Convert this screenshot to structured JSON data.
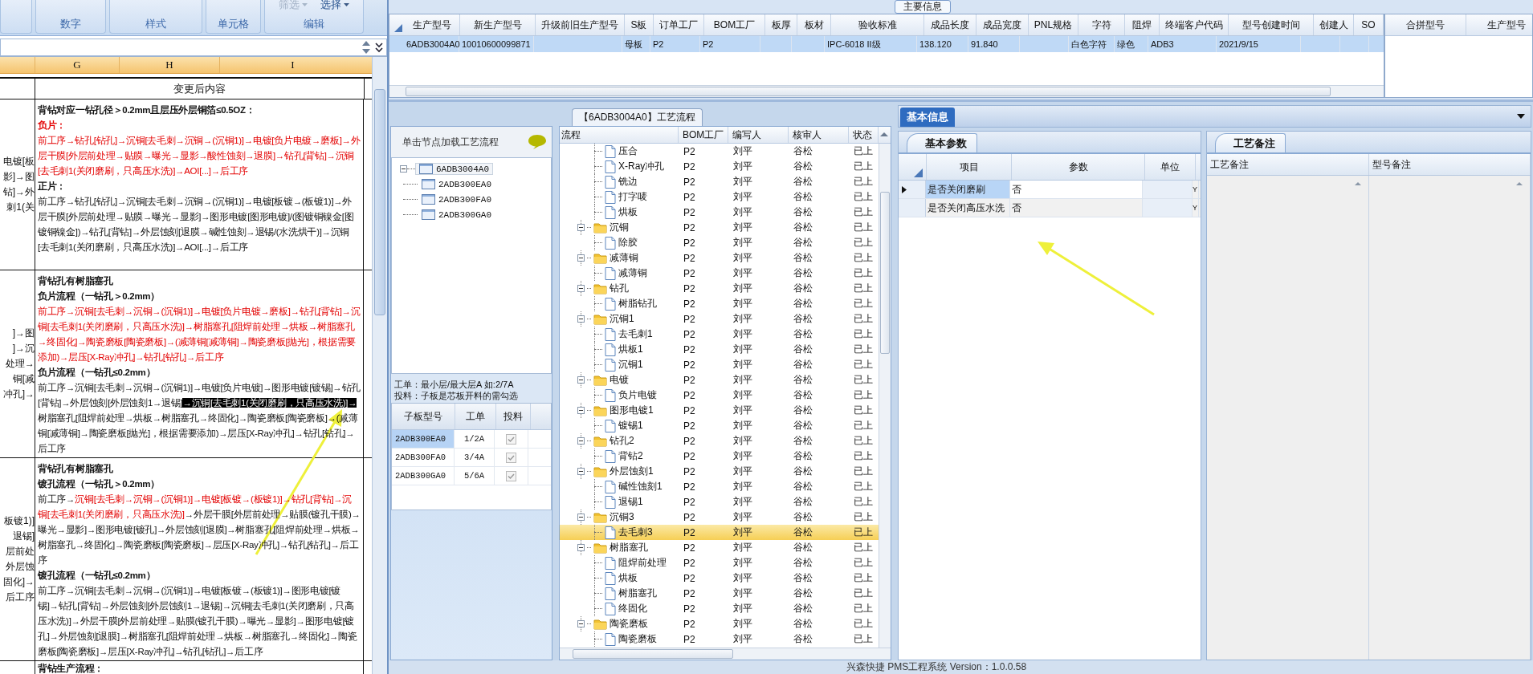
{
  "excel": {
    "ribbon": {
      "groups": [
        "数字",
        "样式",
        "单元格",
        "编辑"
      ],
      "menu_buttons": [
        {
          "label": "筛选",
          "disabled": true
        },
        {
          "label": "选择",
          "disabled": false
        }
      ]
    },
    "columns": [
      "G",
      "H",
      "I"
    ],
    "header": "变更后内容",
    "rows": [
      {
        "left_fragments": [
          "电镀[板",
          "影]→图",
          "钻]→外",
          "刺1(关"
        ],
        "paragraphs": [
          {
            "bold": true,
            "segments": [
              {
                "kind": "normal",
                "text": "背钻对应一钻孔径＞0.2mm且层压外层铜箔≤0.5OZ："
              }
            ]
          },
          {
            "bold": true,
            "segments": [
              {
                "kind": "red",
                "text": "负片："
              }
            ]
          },
          {
            "bold": false,
            "segments": [
              {
                "kind": "red",
                "text": "前工序→钻孔[钻孔]→沉铜[去毛刺→沉铜→(沉铜1)]→电镀[负片电镀→磨板]→外层干膜[外层前处理→贴膜→曝光→显影→酸性蚀刻→退膜]→钻孔[背钻]→沉铜[去毛刺1(关闭磨刷，只高压水洗)]→AOI[...]→后工序"
              }
            ]
          },
          {
            "bold": true,
            "segments": [
              {
                "kind": "normal",
                "text": "正片："
              }
            ]
          },
          {
            "bold": false,
            "segments": [
              {
                "kind": "normal",
                "text": "前工序→钻孔[钻孔]→沉铜[去毛刺→沉铜→(沉铜1)]→电镀[板镀→(板镀1)]→外层干膜[外层前处理→贴膜→曝光→显影]→图形电镀[图形电镀]/(图镀铜镍金[图镀铜镍金])→钻孔[背钻]→外层蚀刻[退膜→碱性蚀刻→退锡/(水洗烘干)]→沉铜[去毛刺1(关闭磨刷，只高压水洗)]→AOI[...]→后工序"
              }
            ]
          }
        ]
      },
      {
        "left_fragments": [
          "]→图",
          "]→沉",
          "处理→",
          "铜[减",
          "冲孔]→"
        ],
        "paragraphs": [
          {
            "bold": true,
            "segments": [
              {
                "kind": "normal",
                "text": "背钻孔有树脂塞孔"
              }
            ]
          },
          {
            "bold": true,
            "segments": [
              {
                "kind": "normal",
                "text": "负片流程（一钻孔＞0.2mm）"
              }
            ]
          },
          {
            "bold": false,
            "segments": [
              {
                "kind": "red",
                "text": "前工序→沉铜[去毛刺→沉铜→(沉铜1)]→电镀[负片电镀→磨板]→钻孔[背钻]→沉铜[去毛刺1(关闭磨刷，只高压水洗)]→树脂塞孔[阻焊前处理→烘板→树脂塞孔→终固化]→陶瓷磨板[陶瓷磨板]→(减薄铜[减薄铜]→陶瓷磨板[抛光]，根据需要添加)→层压[X-Ray冲孔]→钻孔[钻孔]→后工序"
              }
            ]
          },
          {
            "bold": true,
            "segments": [
              {
                "kind": "normal",
                "text": "负片流程（一钻孔≤0.2mm）"
              }
            ]
          },
          {
            "bold": false,
            "segments": [
              {
                "kind": "normal",
                "text": "前工序→沉铜[去毛刺→沉铜→(沉铜1)]→电镀[负片电镀]→图形电镀[镀锡]→钻孔[背钻]→外层蚀刻[外层蚀刻1→退锡]"
              },
              {
                "kind": "highlight",
                "text": "→沉铜[去毛刺1(关闭磨刷，只高压水洗)]→"
              },
              {
                "kind": "normal",
                "text": "树脂塞孔[阻焊前处理→烘板→树脂塞孔→终固化]→陶瓷磨板[陶瓷磨板]→(减薄铜[减薄铜]→陶瓷磨板[抛光]，根据需要添加)→层压[X-Ray冲孔]→钻孔[钻孔]→后工序"
              }
            ]
          }
        ]
      },
      {
        "left_fragments": [
          "板镀1)]",
          "退锡]",
          "层前处",
          "外层蚀",
          "固化]→",
          "后工序"
        ],
        "paragraphs": [
          {
            "bold": true,
            "segments": [
              {
                "kind": "normal",
                "text": "背钻孔有树脂塞孔"
              }
            ]
          },
          {
            "bold": true,
            "segments": [
              {
                "kind": "normal",
                "text": "镀孔流程（一钻孔＞0.2mm）"
              }
            ]
          },
          {
            "bold": false,
            "segments": [
              {
                "kind": "normal",
                "text": "前工序→"
              },
              {
                "kind": "red",
                "text": "沉铜[去毛刺→沉铜→(沉铜1)]→电镀[板镀→(板镀1)]→钻孔[背钻]→沉铜[去毛刺1(关闭磨刷，只高压水洗)]"
              },
              {
                "kind": "normal",
                "text": "→外层干膜[外层前处理→贴膜(镀孔干膜)→曝光→显影]→图形电镀[镀孔]→外层蚀刻[退膜]→树脂塞孔[阻焊前处理→烘板→树脂塞孔→终固化]→陶瓷磨板[陶瓷磨板]→层压[X-Ray冲孔]→钻孔[钻孔]→后工序"
              }
            ]
          },
          {
            "bold": true,
            "segments": [
              {
                "kind": "normal",
                "text": "镀孔流程（一钻孔≤0.2mm）"
              }
            ]
          },
          {
            "bold": false,
            "segments": [
              {
                "kind": "normal",
                "text": "前工序→沉铜[去毛刺→沉铜→(沉铜1)]→电镀[板镀→(板镀1)]→图形电镀[镀锡]→钻孔[背钻]→外层蚀刻[外层蚀刻1→退锡]→沉铜[去毛刺1(关闭磨刷，只高压水洗)]→外层干膜[外层前处理→贴膜(镀孔干膜)→曝光→显影]→图形电镀[镀孔]→外层蚀刻[退膜]→树脂塞孔[阻焊前处理→烘板→树脂塞孔→终固化]→陶瓷磨板[陶瓷磨板]→层压[X-Ray冲孔]→钻孔[钻孔]→后工序"
              }
            ]
          }
        ]
      },
      {
        "paragraphs": [
          {
            "bold": true,
            "segments": [
              {
                "kind": "normal",
                "text": "背钻生产流程："
              }
            ]
          }
        ]
      }
    ]
  },
  "main_info": {
    "title": "主要信息",
    "columns": [
      "生产型号",
      "新生产型号",
      "升级前旧生产型号",
      "S板",
      "订单工厂",
      "BOM工厂",
      "板厚",
      "板材",
      "验收标准",
      "成品长度",
      "成品宽度",
      "PNL规格",
      "字符",
      "阻焊",
      "终端客户代码",
      "型号创建时间",
      "创建人",
      "SO"
    ],
    "rows": [
      {
        "selected": true,
        "cells": [
          "6ADB3004A0",
          "10010600099871",
          null,
          "母板",
          "P2",
          "P2",
          null,
          null,
          "IPC-6018 II级",
          "138.120",
          "91.840",
          null,
          "白色字符",
          "绿色",
          "ADB3",
          "2021/9/15",
          null,
          null
        ]
      }
    ],
    "merge_table": {
      "columns": [
        "合拼型号",
        "生产型号"
      ]
    }
  },
  "node_panel": {
    "hint": "单击节点加载工艺流程",
    "tree": {
      "label": "6ADB3004A0",
      "expanded": true,
      "selected": true,
      "children": [
        {
          "label": "2ADB300EA0",
          "selected": false
        },
        {
          "label": "2ADB300FA0",
          "selected": false
        },
        {
          "label": "2ADB300GA0",
          "selected": false
        }
      ]
    },
    "notes": [
      "工单：最小层/最大层A 如:2/7A",
      "投料：子板是芯板开料的需勾选"
    ],
    "sub_boards": {
      "columns": [
        "子板型号",
        "工单",
        "投料"
      ],
      "rows": [
        {
          "model": "2ADB300EA0",
          "order": "1/2A",
          "feed": true,
          "selected": true
        },
        {
          "model": "2ADB300FA0",
          "order": "3/4A",
          "feed": true,
          "selected": false
        },
        {
          "model": "2ADB300GA0",
          "order": "5/6A",
          "feed": true,
          "selected": false
        }
      ]
    }
  },
  "flow": {
    "tab": "【6ADB3004A0】工艺流程",
    "columns": [
      "流程",
      "BOM工厂",
      "编写人",
      "核审人",
      "状态"
    ],
    "continued_steps": [
      {
        "name": "压合",
        "bom": "P2",
        "author": "刘平",
        "reviewer": "谷松",
        "status": "已上",
        "selected": false
      },
      {
        "name": "X-Ray冲孔",
        "bom": "P2",
        "author": "刘平",
        "reviewer": "谷松",
        "status": "已上",
        "selected": false
      },
      {
        "name": "铣边",
        "bom": "P2",
        "author": "刘平",
        "reviewer": "谷松",
        "status": "已上",
        "selected": false
      },
      {
        "name": "打字唛",
        "bom": "P2",
        "author": "刘平",
        "reviewer": "谷松",
        "status": "已上",
        "selected": false
      },
      {
        "name": "烘板",
        "bom": "P2",
        "author": "刘平",
        "reviewer": "谷松",
        "status": "已上",
        "selected": false
      }
    ],
    "groups": [
      {
        "name": "沉铜",
        "bom": "P2",
        "author": "刘平",
        "reviewer": "谷松",
        "status": "已上",
        "selected": false,
        "expanded": true,
        "children": [
          {
            "name": "除胶",
            "bom": "P2",
            "author": "刘平",
            "reviewer": "谷松",
            "status": "已上",
            "selected": false
          }
        ]
      },
      {
        "name": "减薄铜",
        "bom": "P2",
        "author": "刘平",
        "reviewer": "谷松",
        "status": "已上",
        "selected": false,
        "expanded": true,
        "children": [
          {
            "name": "减薄铜",
            "bom": "P2",
            "author": "刘平",
            "reviewer": "谷松",
            "status": "已上",
            "selected": false
          }
        ]
      },
      {
        "name": "钻孔",
        "bom": "P2",
        "author": "刘平",
        "reviewer": "谷松",
        "status": "已上",
        "selected": false,
        "expanded": true,
        "children": [
          {
            "name": "树脂钻孔",
            "bom": "P2",
            "author": "刘平",
            "reviewer": "谷松",
            "status": "已上",
            "selected": false
          }
        ]
      },
      {
        "name": "沉铜1",
        "bom": "P2",
        "author": "刘平",
        "reviewer": "谷松",
        "status": "已上",
        "selected": false,
        "expanded": true,
        "children": [
          {
            "name": "去毛刺1",
            "bom": "P2",
            "author": "刘平",
            "reviewer": "谷松",
            "status": "已上",
            "selected": false
          },
          {
            "name": "烘板1",
            "bom": "P2",
            "author": "刘平",
            "reviewer": "谷松",
            "status": "已上",
            "selected": false
          },
          {
            "name": "沉铜1",
            "bom": "P2",
            "author": "刘平",
            "reviewer": "谷松",
            "status": "已上",
            "selected": false
          }
        ]
      },
      {
        "name": "电镀",
        "bom": "P2",
        "author": "刘平",
        "reviewer": "谷松",
        "status": "已上",
        "selected": false,
        "expanded": true,
        "children": [
          {
            "name": "负片电镀",
            "bom": "P2",
            "author": "刘平",
            "reviewer": "谷松",
            "status": "已上",
            "selected": false
          }
        ]
      },
      {
        "name": "图形电镀1",
        "bom": "P2",
        "author": "刘平",
        "reviewer": "谷松",
        "status": "已上",
        "selected": false,
        "expanded": true,
        "children": [
          {
            "name": "镀锡1",
            "bom": "P2",
            "author": "刘平",
            "reviewer": "谷松",
            "status": "已上",
            "selected": false
          }
        ]
      },
      {
        "name": "钻孔2",
        "bom": "P2",
        "author": "刘平",
        "reviewer": "谷松",
        "status": "已上",
        "selected": false,
        "expanded": true,
        "children": [
          {
            "name": "背钻2",
            "bom": "P2",
            "author": "刘平",
            "reviewer": "谷松",
            "status": "已上",
            "selected": false
          }
        ]
      },
      {
        "name": "外层蚀刻1",
        "bom": "P2",
        "author": "刘平",
        "reviewer": "谷松",
        "status": "已上",
        "selected": false,
        "expanded": true,
        "children": [
          {
            "name": "碱性蚀刻1",
            "bom": "P2",
            "author": "刘平",
            "reviewer": "谷松",
            "status": "已上",
            "selected": false
          },
          {
            "name": "退锡1",
            "bom": "P2",
            "author": "刘平",
            "reviewer": "谷松",
            "status": "已上",
            "selected": false
          }
        ]
      },
      {
        "name": "沉铜3",
        "bom": "P2",
        "author": "刘平",
        "reviewer": "谷松",
        "status": "已上",
        "selected": false,
        "expanded": true,
        "children": [
          {
            "name": "去毛刺3",
            "bom": "P2",
            "author": "刘平",
            "reviewer": "谷松",
            "status": "已上",
            "selected": true
          }
        ]
      },
      {
        "name": "树脂塞孔",
        "bom": "P2",
        "author": "刘平",
        "reviewer": "谷松",
        "status": "已上",
        "selected": false,
        "expanded": true,
        "children": [
          {
            "name": "阻焊前处理",
            "bom": "P2",
            "author": "刘平",
            "reviewer": "谷松",
            "status": "已上",
            "selected": false
          },
          {
            "name": "烘板",
            "bom": "P2",
            "author": "刘平",
            "reviewer": "谷松",
            "status": "已上",
            "selected": false
          },
          {
            "name": "树脂塞孔",
            "bom": "P2",
            "author": "刘平",
            "reviewer": "谷松",
            "status": "已上",
            "selected": false
          },
          {
            "name": "终固化",
            "bom": "P2",
            "author": "刘平",
            "reviewer": "谷松",
            "status": "已上",
            "selected": false
          }
        ]
      },
      {
        "name": "陶瓷磨板",
        "bom": "P2",
        "author": "刘平",
        "reviewer": "谷松",
        "status": "已上",
        "selected": false,
        "expanded": true,
        "children": [
          {
            "name": "陶瓷磨板",
            "bom": "P2",
            "author": "刘平",
            "reviewer": "谷松",
            "status": "已上",
            "selected": false
          }
        ]
      }
    ]
  },
  "basic_info": {
    "tabs": [
      {
        "label": "基本信息",
        "selected": true
      }
    ],
    "params": {
      "tab": "基本参数",
      "columns": [
        "项目",
        "参数",
        "单位"
      ],
      "rows": [
        {
          "item": "是否关闭磨刷",
          "value": "否",
          "flag": "Y",
          "current": true
        },
        {
          "item": "是否关闭高压水洗",
          "value": "否",
          "flag": "Y",
          "current": false
        }
      ]
    },
    "remarks": {
      "tab": "工艺备注",
      "columns": [
        "工艺备注",
        "型号备注"
      ]
    }
  },
  "status_bar": "兴森快捷 PMS工程系统 Version：1.0.0.58"
}
